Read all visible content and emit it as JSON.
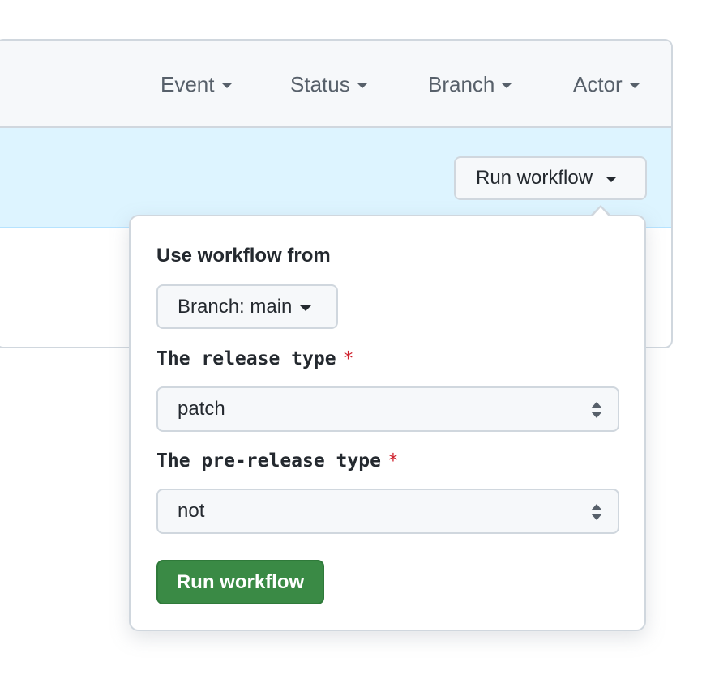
{
  "filters": {
    "event": "Event",
    "status": "Status",
    "branch": "Branch",
    "actor": "Actor"
  },
  "run_workflow_toggle": "Run workflow",
  "popover": {
    "use_workflow_from_label": "Use workflow from",
    "branch_button": "Branch: main",
    "release_type": {
      "label": "The release type",
      "required_mark": "*",
      "value": "patch"
    },
    "prerelease_type": {
      "label": "The pre-release type",
      "required_mark": "*",
      "value": "not"
    },
    "submit_button": "Run workflow"
  },
  "colors": {
    "header_bg": "#f6f8fa",
    "highlight_row_bg": "#ddf4ff",
    "border": "#d0d7de",
    "required": "#cf222e",
    "primary_button": "#3a8a45"
  },
  "icons": {
    "dropdown": "caret-down-icon",
    "select": "up-down-arrows-icon"
  }
}
